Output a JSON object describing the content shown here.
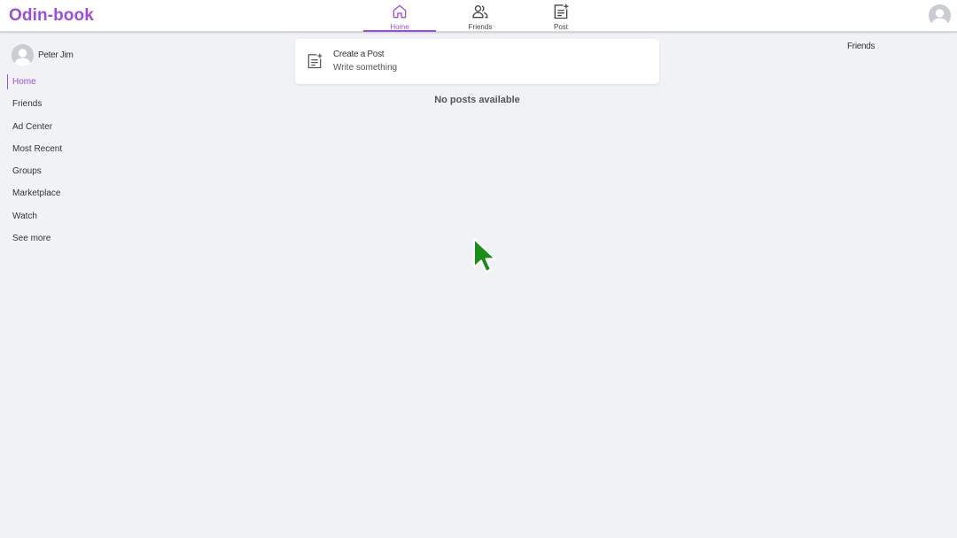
{
  "app": {
    "brand": "Odin-book"
  },
  "nav": {
    "tabs": [
      {
        "label": "Home",
        "icon": "home-icon",
        "active": true
      },
      {
        "label": "Friends",
        "icon": "friends-icon",
        "active": false
      },
      {
        "label": "Post",
        "icon": "post-icon",
        "active": false
      }
    ]
  },
  "profile": {
    "name": "Peter Jim"
  },
  "sidebar": {
    "items": [
      {
        "label": "Home",
        "active": true
      },
      {
        "label": "Friends"
      },
      {
        "label": "Ad Center"
      },
      {
        "label": "Most Recent"
      },
      {
        "label": "Groups"
      },
      {
        "label": "Marketplace"
      },
      {
        "label": "Watch"
      },
      {
        "label": "See more"
      }
    ]
  },
  "create_post": {
    "title": "Create a Post",
    "subtitle": "Write something"
  },
  "feed": {
    "empty_message": "No posts available"
  },
  "right_panel": {
    "heading": "Friends"
  },
  "colors": {
    "accent": "#9b4dde",
    "background": "#f0f2f5",
    "card": "#ffffff",
    "cursor": "#1a8c1a"
  }
}
